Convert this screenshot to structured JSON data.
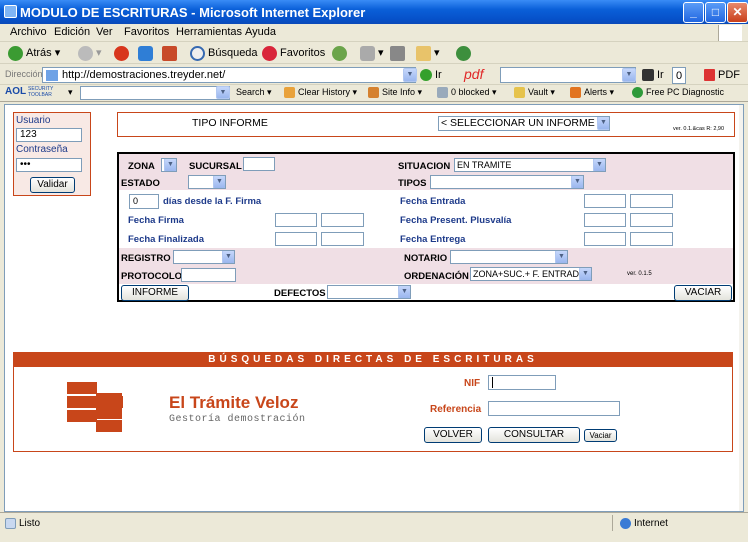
{
  "window": {
    "title": "MODULO DE ESCRITURAS - Microsoft Internet Explorer"
  },
  "menu": [
    "Archivo",
    "Edición",
    "Ver",
    "Favoritos",
    "Herramientas",
    "Ayuda"
  ],
  "toolbar": {
    "back": "Atrás",
    "search": "Búsqueda",
    "favorites": "Favoritos"
  },
  "address": {
    "label": "Dirección",
    "url": "http://demostraciones.treyder.net/",
    "go": "Ir",
    "pdf_logo": "pdf",
    "go2": "Ir",
    "count": "0",
    "pdf": "PDF"
  },
  "aolbar": {
    "logo": "AOL",
    "security_line1": "SECURITY",
    "security_line2": "TOOLBAR",
    "search": "Search",
    "clear_history": "Clear History",
    "site_info": "Site Info",
    "blocked": "0 blocked",
    "vault": "Vault",
    "alerts": "Alerts",
    "diagnostic": "Free PC Diagnostic"
  },
  "login": {
    "user_label": "Usuario",
    "user_value": "123",
    "pass_label": "Contraseña",
    "pass_value": "•••",
    "validate": "Validar"
  },
  "report": {
    "type_label": "TIPO INFORME",
    "select_value": "< SELECCIONAR UN INFORME >",
    "version": "ver. 0.1.&cas R: 2,90"
  },
  "filters": {
    "zona": "ZONA",
    "sucursal": "SUCURSAL",
    "situacion": "SITUACION",
    "situacion_value": "EN TRAMITE",
    "estado": "ESTADO",
    "tipos": "TIPOS",
    "days_value": "0",
    "days_label": "días desde la F. Firma",
    "fecha_entrada": "Fecha Entrada",
    "fecha_firma": "Fecha Firma",
    "fecha_plusvalia": "Fecha Present. Plusvalía",
    "fecha_finalizada": "Fecha Finalizada",
    "fecha_entrega": "Fecha Entrega",
    "registro": "REGISTRO",
    "notario": "NOTARIO",
    "protocolo": "PROTOCOLO",
    "ordenacion": "ORDENACIÓN",
    "ordenacion_value": "ZONA+SUC.+ F. ENTRADA",
    "version": "ver. 0.1.5",
    "informe_btn": "INFORME",
    "defectos": "DEFECTOS",
    "vaciar_btn": "VACIAR"
  },
  "direct": {
    "header": "BÚSQUEDAS DIRECTAS DE ESCRITURAS",
    "company": "El Trámite Veloz",
    "tagline": "Gestoría demostración",
    "nif": "NIF",
    "referencia": "Referencia",
    "volver": "VOLVER",
    "consultar": "CONSULTAR",
    "vaciar": "Vaciar"
  },
  "status": {
    "left": "Listo",
    "zone": "Internet"
  },
  "colors": {
    "accent": "#c8461a",
    "pink": "#f0dfe5",
    "title_blue": "#0a5fd8"
  }
}
